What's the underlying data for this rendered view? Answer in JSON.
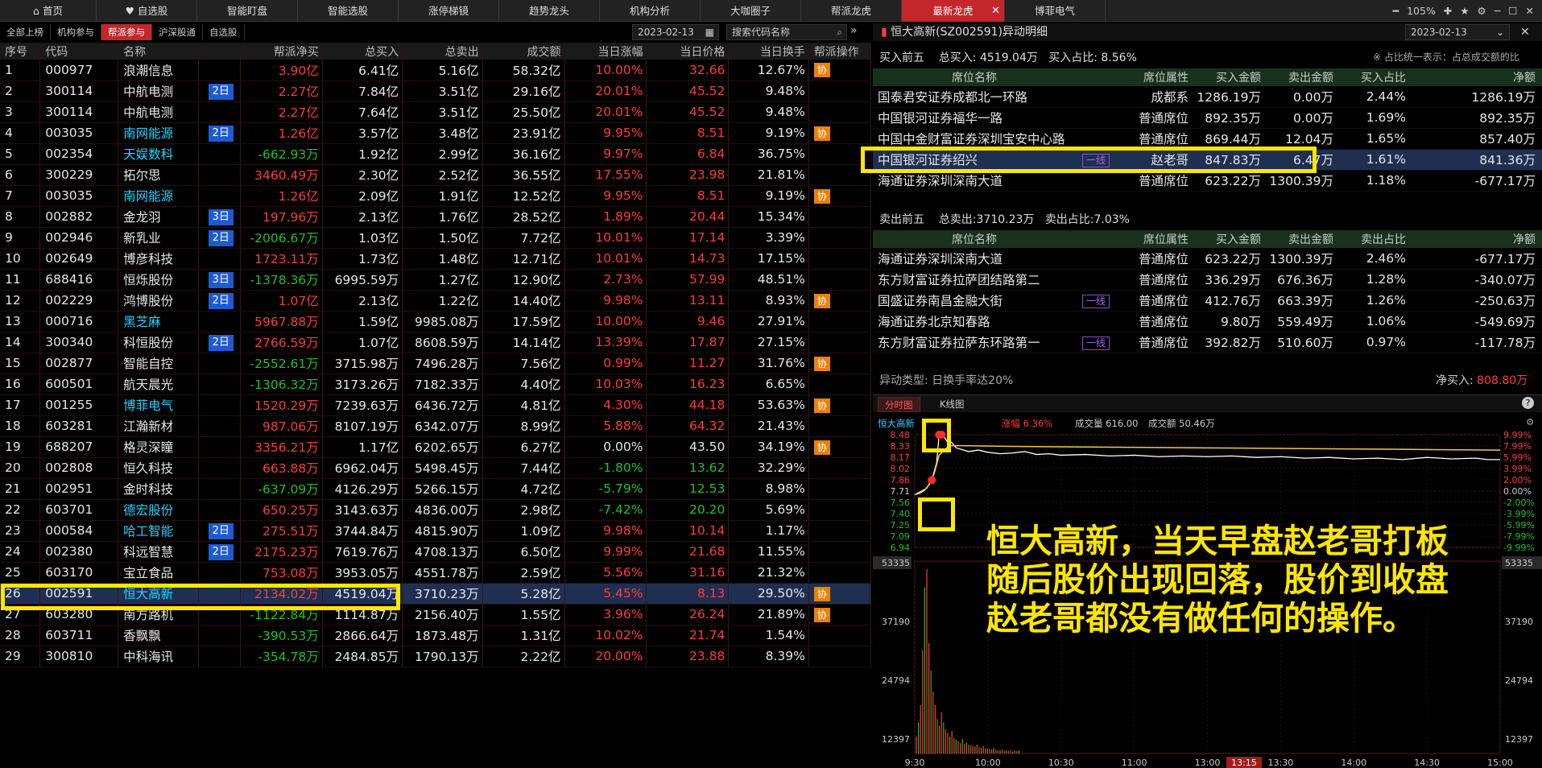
{
  "topbar": {
    "tabs": [
      "首页",
      "自选股",
      "智能盯盘",
      "智能选股",
      "涨停梯镜",
      "趋势龙头",
      "机构分析",
      "大咖圈子",
      "帮派龙虎",
      "最新龙虎",
      "博菲电气"
    ],
    "active_tab": "最新龙虎",
    "zoom": "105%"
  },
  "subtabs": [
    "全部上榜",
    "机构参与",
    "帮派参与",
    "沪深股通",
    "自选股"
  ],
  "active_subtab": "帮派参与",
  "date": "2023-02-13",
  "search_placeholder": "搜索代码名称",
  "table": {
    "headers": [
      "序号",
      "代码",
      "名称",
      "",
      "帮派净买",
      "总买入",
      "总卖出",
      "成交额",
      "当日涨幅",
      "当日价格",
      "当日换手",
      "帮派操作"
    ],
    "rows": [
      {
        "n": "1",
        "code": "000977",
        "name": "浪潮信息",
        "nc": "white",
        "badge": "",
        "net": "3.90亿",
        "netc": "red",
        "buy": "6.41亿",
        "sell": "5.16亿",
        "amt": "58.32亿",
        "chg": "10.00%",
        "chgc": "red",
        "price": "32.66",
        "pc": "red",
        "turn": "12.67%",
        "op": "协"
      },
      {
        "n": "2",
        "code": "300114",
        "name": "中航电测",
        "nc": "white",
        "badge": "2日",
        "net": "2.27亿",
        "netc": "red",
        "buy": "7.84亿",
        "sell": "3.51亿",
        "amt": "29.16亿",
        "chg": "20.01%",
        "chgc": "red",
        "price": "45.52",
        "pc": "red",
        "turn": "9.48%",
        "op": ""
      },
      {
        "n": "3",
        "code": "300114",
        "name": "中航电测",
        "nc": "white",
        "badge": "",
        "net": "2.27亿",
        "netc": "red",
        "buy": "7.64亿",
        "sell": "3.51亿",
        "amt": "25.50亿",
        "chg": "20.01%",
        "chgc": "red",
        "price": "45.52",
        "pc": "red",
        "turn": "9.48%",
        "op": ""
      },
      {
        "n": "4",
        "code": "003035",
        "name": "南网能源",
        "nc": "cyan",
        "badge": "2日",
        "net": "1.26亿",
        "netc": "red",
        "buy": "3.57亿",
        "sell": "3.48亿",
        "amt": "23.91亿",
        "chg": "9.95%",
        "chgc": "red",
        "price": "8.51",
        "pc": "red",
        "turn": "9.19%",
        "op": "协"
      },
      {
        "n": "5",
        "code": "002354",
        "name": "天娱数科",
        "nc": "cyan",
        "badge": "",
        "net": "-662.93万",
        "netc": "green",
        "buy": "1.92亿",
        "sell": "2.99亿",
        "amt": "36.16亿",
        "chg": "9.97%",
        "chgc": "red",
        "price": "6.84",
        "pc": "red",
        "turn": "36.75%",
        "op": ""
      },
      {
        "n": "6",
        "code": "300229",
        "name": "拓尔思",
        "nc": "white",
        "badge": "",
        "net": "3460.49万",
        "netc": "red",
        "buy": "2.30亿",
        "sell": "2.52亿",
        "amt": "36.55亿",
        "chg": "17.55%",
        "chgc": "red",
        "price": "23.98",
        "pc": "red",
        "turn": "21.81%",
        "op": ""
      },
      {
        "n": "7",
        "code": "003035",
        "name": "南网能源",
        "nc": "cyan",
        "badge": "",
        "net": "1.26亿",
        "netc": "red",
        "buy": "2.09亿",
        "sell": "1.91亿",
        "amt": "12.52亿",
        "chg": "9.95%",
        "chgc": "red",
        "price": "8.51",
        "pc": "red",
        "turn": "9.19%",
        "op": "协"
      },
      {
        "n": "8",
        "code": "002882",
        "name": "金龙羽",
        "nc": "white",
        "badge": "3日",
        "net": "197.96万",
        "netc": "red",
        "buy": "2.13亿",
        "sell": "1.76亿",
        "amt": "28.52亿",
        "chg": "1.89%",
        "chgc": "red",
        "price": "20.44",
        "pc": "red",
        "turn": "15.34%",
        "op": ""
      },
      {
        "n": "9",
        "code": "002946",
        "name": "新乳业",
        "nc": "white",
        "badge": "2日",
        "net": "-2006.67万",
        "netc": "green",
        "buy": "1.03亿",
        "sell": "1.50亿",
        "amt": "7.72亿",
        "chg": "10.01%",
        "chgc": "red",
        "price": "17.14",
        "pc": "red",
        "turn": "3.39%",
        "op": ""
      },
      {
        "n": "10",
        "code": "002649",
        "name": "博彦科技",
        "nc": "white",
        "badge": "",
        "net": "1723.11万",
        "netc": "red",
        "buy": "1.73亿",
        "sell": "1.48亿",
        "amt": "12.71亿",
        "chg": "10.01%",
        "chgc": "red",
        "price": "14.73",
        "pc": "red",
        "turn": "17.15%",
        "op": ""
      },
      {
        "n": "11",
        "code": "688416",
        "name": "恒烁股份",
        "nc": "white",
        "badge": "3日",
        "net": "-1378.36万",
        "netc": "green",
        "buy": "6995.59万",
        "sell": "1.27亿",
        "amt": "12.90亿",
        "chg": "2.73%",
        "chgc": "red",
        "price": "57.99",
        "pc": "red",
        "turn": "48.51%",
        "op": ""
      },
      {
        "n": "12",
        "code": "002229",
        "name": "鸿博股份",
        "nc": "white",
        "badge": "2日",
        "net": "1.07亿",
        "netc": "red",
        "buy": "2.13亿",
        "sell": "1.22亿",
        "amt": "14.40亿",
        "chg": "9.98%",
        "chgc": "red",
        "price": "13.11",
        "pc": "red",
        "turn": "8.93%",
        "op": "协"
      },
      {
        "n": "13",
        "code": "000716",
        "name": "黑芝麻",
        "nc": "cyan",
        "badge": "",
        "net": "5967.88万",
        "netc": "red",
        "buy": "1.59亿",
        "sell": "9985.08万",
        "amt": "17.59亿",
        "chg": "10.00%",
        "chgc": "red",
        "price": "9.46",
        "pc": "red",
        "turn": "27.91%",
        "op": ""
      },
      {
        "n": "14",
        "code": "300340",
        "name": "科恒股份",
        "nc": "white",
        "badge": "2日",
        "net": "2766.59万",
        "netc": "red",
        "buy": "1.07亿",
        "sell": "8608.59万",
        "amt": "14.14亿",
        "chg": "13.39%",
        "chgc": "red",
        "price": "17.87",
        "pc": "red",
        "turn": "27.15%",
        "op": ""
      },
      {
        "n": "15",
        "code": "002877",
        "name": "智能自控",
        "nc": "white",
        "badge": "",
        "net": "-2552.61万",
        "netc": "green",
        "buy": "3715.98万",
        "sell": "7496.28万",
        "amt": "7.56亿",
        "chg": "0.99%",
        "chgc": "red",
        "price": "11.27",
        "pc": "red",
        "turn": "31.76%",
        "op": "协"
      },
      {
        "n": "16",
        "code": "600501",
        "name": "航天晨光",
        "nc": "white",
        "badge": "",
        "net": "-1306.32万",
        "netc": "green",
        "buy": "3173.26万",
        "sell": "7182.33万",
        "amt": "4.40亿",
        "chg": "10.03%",
        "chgc": "red",
        "price": "16.23",
        "pc": "red",
        "turn": "6.65%",
        "op": ""
      },
      {
        "n": "17",
        "code": "001255",
        "name": "博菲电气",
        "nc": "cyan",
        "badge": "",
        "net": "1520.29万",
        "netc": "red",
        "buy": "7239.63万",
        "sell": "6436.72万",
        "amt": "4.81亿",
        "chg": "4.30%",
        "chgc": "red",
        "price": "44.18",
        "pc": "red",
        "turn": "53.63%",
        "op": "协"
      },
      {
        "n": "18",
        "code": "603281",
        "name": "江瀚新材",
        "nc": "white",
        "badge": "",
        "net": "987.06万",
        "netc": "red",
        "buy": "8107.19万",
        "sell": "6342.07万",
        "amt": "8.99亿",
        "chg": "5.88%",
        "chgc": "red",
        "price": "64.32",
        "pc": "red",
        "turn": "21.43%",
        "op": ""
      },
      {
        "n": "19",
        "code": "688207",
        "name": "格灵深瞳",
        "nc": "white",
        "badge": "",
        "net": "3356.21万",
        "netc": "red",
        "buy": "1.17亿",
        "sell": "6202.65万",
        "amt": "6.27亿",
        "chg": "0.00%",
        "chgc": "white",
        "price": "43.50",
        "pc": "white",
        "turn": "34.19%",
        "op": "协"
      },
      {
        "n": "20",
        "code": "002808",
        "name": "恒久科技",
        "nc": "white",
        "badge": "",
        "net": "663.88万",
        "netc": "red",
        "buy": "6962.04万",
        "sell": "5498.45万",
        "amt": "7.44亿",
        "chg": "-1.80%",
        "chgc": "green",
        "price": "13.62",
        "pc": "green",
        "turn": "32.29%",
        "op": ""
      },
      {
        "n": "21",
        "code": "002951",
        "name": "金时科技",
        "nc": "white",
        "badge": "",
        "net": "-637.09万",
        "netc": "green",
        "buy": "4126.29万",
        "sell": "5266.15万",
        "amt": "4.72亿",
        "chg": "-5.79%",
        "chgc": "green",
        "price": "12.53",
        "pc": "green",
        "turn": "8.98%",
        "op": ""
      },
      {
        "n": "22",
        "code": "603701",
        "name": "德宏股份",
        "nc": "cyan",
        "badge": "",
        "net": "650.25万",
        "netc": "red",
        "buy": "3143.63万",
        "sell": "4836.00万",
        "amt": "2.98亿",
        "chg": "-7.42%",
        "chgc": "green",
        "price": "20.20",
        "pc": "green",
        "turn": "5.69%",
        "op": ""
      },
      {
        "n": "23",
        "code": "000584",
        "name": "哈工智能",
        "nc": "cyan",
        "badge": "2日",
        "net": "275.51万",
        "netc": "red",
        "buy": "3744.84万",
        "sell": "4815.90万",
        "amt": "1.09亿",
        "chg": "9.98%",
        "chgc": "red",
        "price": "10.14",
        "pc": "red",
        "turn": "1.17%",
        "op": ""
      },
      {
        "n": "24",
        "code": "002380",
        "name": "科远智慧",
        "nc": "white",
        "badge": "2日",
        "net": "2175.23万",
        "netc": "red",
        "buy": "7619.76万",
        "sell": "4708.13万",
        "amt": "6.50亿",
        "chg": "9.99%",
        "chgc": "red",
        "price": "21.68",
        "pc": "red",
        "turn": "11.55%",
        "op": ""
      },
      {
        "n": "25",
        "code": "603170",
        "name": "宝立食品",
        "nc": "white",
        "badge": "",
        "net": "753.08万",
        "netc": "red",
        "buy": "3953.05万",
        "sell": "4551.78万",
        "amt": "2.59亿",
        "chg": "5.56%",
        "chgc": "red",
        "price": "31.16",
        "pc": "red",
        "turn": "21.32%",
        "op": ""
      },
      {
        "n": "26",
        "code": "002591",
        "name": "恒大高新",
        "nc": "cyan",
        "badge": "",
        "net": "2134.02万",
        "netc": "red",
        "buy": "4519.04万",
        "sell": "3710.23万",
        "amt": "5.28亿",
        "chg": "5.45%",
        "chgc": "red",
        "price": "8.13",
        "pc": "red",
        "turn": "29.50%",
        "op": "协"
      },
      {
        "n": "27",
        "code": "603280",
        "name": "南方路机",
        "nc": "white",
        "badge": "",
        "net": "-1122.84万",
        "netc": "green",
        "buy": "1114.87万",
        "sell": "2156.40万",
        "amt": "1.55亿",
        "chg": "3.96%",
        "chgc": "red",
        "price": "26.24",
        "pc": "red",
        "turn": "21.89%",
        "op": "协"
      },
      {
        "n": "28",
        "code": "603711",
        "name": "香飘飘",
        "nc": "white",
        "badge": "",
        "net": "-390.53万",
        "netc": "green",
        "buy": "2866.64万",
        "sell": "1873.48万",
        "amt": "1.31亿",
        "chg": "10.02%",
        "chgc": "red",
        "price": "21.74",
        "pc": "red",
        "turn": "1.54%",
        "op": ""
      },
      {
        "n": "29",
        "code": "300810",
        "name": "中科海讯",
        "nc": "white",
        "badge": "",
        "net": "-354.78万",
        "netc": "green",
        "buy": "2484.85万",
        "sell": "1790.13万",
        "amt": "2.22亿",
        "chg": "20.00%",
        "chgc": "red",
        "price": "23.88",
        "pc": "red",
        "turn": "8.39%",
        "op": ""
      }
    ],
    "selected_row": "26"
  },
  "detail": {
    "title": "恒大高新(SZ002591)异动明细",
    "date": "2023-02-13",
    "buy_summary": {
      "label": "买入前五",
      "total": "总买入: 4519.04万",
      "ratio": "买入占比: 8.56%"
    },
    "note": "※ 占比统一表示：占总成交额的比",
    "buy_headers": [
      "席位名称",
      "",
      "席位属性",
      "买入金额",
      "卖出金额",
      "买入占比",
      "净额"
    ],
    "buy_rows": [
      {
        "name": "国泰君安证券成都北一环路",
        "tag": "",
        "attr": "成都系",
        "buy": "1286.19万",
        "sell": "0.00万",
        "ratio": "2.44%",
        "net": "1286.19万"
      },
      {
        "name": "中国银河证券福华一路",
        "tag": "",
        "attr": "普通席位",
        "buy": "892.35万",
        "sell": "0.00万",
        "ratio": "1.69%",
        "net": "892.35万"
      },
      {
        "name": "中国中金财富证券深圳宝安中心路",
        "tag": "",
        "attr": "普通席位",
        "buy": "869.44万",
        "sell": "12.04万",
        "ratio": "1.65%",
        "net": "857.40万"
      },
      {
        "name": "中国银河证券绍兴",
        "tag": "一线",
        "attr": "赵老哥",
        "buy": "847.83万",
        "sell": "6.47万",
        "ratio": "1.61%",
        "net": "841.36万"
      },
      {
        "name": "海通证券深圳深南大道",
        "tag": "",
        "attr": "普通席位",
        "buy": "623.22万",
        "sell": "1300.39万",
        "ratio": "1.18%",
        "net": "-677.17万"
      }
    ],
    "sell_summary": {
      "label": "卖出前五",
      "total": "总卖出:3710.23万",
      "ratio": "卖出占比:7.03%"
    },
    "sell_headers": [
      "席位名称",
      "",
      "席位属性",
      "买入金额",
      "卖出金额",
      "卖出占比",
      "净额"
    ],
    "sell_rows": [
      {
        "name": "海通证券深圳深南大道",
        "tag": "",
        "attr": "普通席位",
        "buy": "623.22万",
        "sell": "1300.39万",
        "ratio": "2.46%",
        "net": "-677.17万"
      },
      {
        "name": "东方财富证券拉萨团结路第二",
        "tag": "",
        "attr": "普通席位",
        "buy": "336.29万",
        "sell": "676.36万",
        "ratio": "1.28%",
        "net": "-340.07万"
      },
      {
        "name": "国盛证券南昌金融大街",
        "tag": "一线",
        "attr": "普通席位",
        "buy": "412.76万",
        "sell": "663.39万",
        "ratio": "1.26%",
        "net": "-250.63万"
      },
      {
        "name": "海通证券北京知春路",
        "tag": "",
        "attr": "普通席位",
        "buy": "9.80万",
        "sell": "559.49万",
        "ratio": "1.06%",
        "net": "-549.69万"
      },
      {
        "name": "东方财富证券拉萨东环路第一",
        "tag": "一线",
        "attr": "普通席位",
        "buy": "392.82万",
        "sell": "510.60万",
        "ratio": "0.97%",
        "net": "-117.78万"
      }
    ],
    "anomaly_type": "异动类型: 日换手率达20%",
    "net_buy_label": "净买入:",
    "net_buy_value": "808.80万"
  },
  "chart_tabs": [
    "分时图",
    "K线图"
  ],
  "chart_info": {
    "name": "恒大高新",
    "change": "涨幅 6.36%",
    "volume": "成交量 616.00",
    "amount": "成交额 50.46万"
  },
  "chart_data": {
    "type": "line",
    "title": "",
    "price_ticks": [
      "8.48",
      "8.33",
      "8.17",
      "8.02",
      "7.86",
      "7.71",
      "7.56",
      "7.40",
      "7.25",
      "7.09",
      "6.94"
    ],
    "pct_ticks": [
      "9.99%",
      "7.99%",
      "5.99%",
      "3.99%",
      "2.00%",
      "0.00%",
      "-2.00%",
      "-3.99%",
      "-5.99%",
      "-7.99%",
      "-9.99%"
    ],
    "pct_colors": [
      "red",
      "red",
      "red",
      "red",
      "red",
      "white",
      "green",
      "green",
      "green",
      "green",
      "green"
    ],
    "vol_ticks": [
      "53335",
      "37190",
      "24794",
      "12397"
    ],
    "time_ticks": [
      "9:30",
      "10:00",
      "10:30",
      "11:00",
      "13:00",
      "13:30",
      "14:00",
      "14:30",
      "15:00"
    ],
    "cursor_time": "13:15",
    "ylim": [
      6.94,
      8.48
    ],
    "price_series": [
      [
        0,
        7.66
      ],
      [
        2,
        7.68
      ],
      [
        4,
        7.72
      ],
      [
        6,
        7.8
      ],
      [
        7,
        7.86
      ],
      [
        9,
        8.1
      ],
      [
        10,
        8.48
      ],
      [
        11,
        8.44
      ],
      [
        12,
        8.46
      ],
      [
        13,
        8.4
      ],
      [
        14,
        8.36
      ],
      [
        15,
        8.38
      ],
      [
        17,
        8.3
      ],
      [
        19,
        8.28
      ],
      [
        22,
        8.25
      ],
      [
        26,
        8.27
      ],
      [
        30,
        8.24
      ],
      [
        35,
        8.22
      ],
      [
        40,
        8.23
      ],
      [
        45,
        8.25
      ],
      [
        50,
        8.21
      ],
      [
        55,
        8.22
      ],
      [
        60,
        8.2
      ],
      [
        70,
        8.21
      ],
      [
        80,
        8.19
      ],
      [
        90,
        8.2
      ],
      [
        100,
        8.18
      ],
      [
        110,
        8.19
      ],
      [
        120,
        8.18
      ],
      [
        130,
        8.19
      ],
      [
        140,
        8.17
      ],
      [
        150,
        8.18
      ],
      [
        160,
        8.16
      ],
      [
        170,
        8.17
      ],
      [
        180,
        8.15
      ],
      [
        190,
        8.16
      ],
      [
        200,
        8.14
      ],
      [
        210,
        8.17
      ],
      [
        220,
        8.15
      ],
      [
        230,
        8.16
      ],
      [
        235,
        8.14
      ],
      [
        240,
        8.14
      ]
    ],
    "avg_series": [
      [
        0,
        7.66
      ],
      [
        5,
        7.75
      ],
      [
        8,
        7.95
      ],
      [
        10,
        8.2
      ],
      [
        14,
        8.33
      ],
      [
        20,
        8.33
      ],
      [
        40,
        8.32
      ],
      [
        80,
        8.31
      ],
      [
        120,
        8.3
      ],
      [
        160,
        8.29
      ],
      [
        200,
        8.28
      ],
      [
        240,
        8.27
      ]
    ],
    "volume_series": [
      5000,
      9000,
      14000,
      30000,
      48000,
      53335,
      32000,
      24000,
      18000,
      14000,
      10000,
      8000,
      12000,
      9000,
      7000,
      6000,
      5000,
      6500,
      4500,
      4000,
      3500,
      3000,
      4200,
      2800,
      3200,
      2500,
      2400,
      2200,
      2000,
      2600,
      1800,
      1600,
      2100,
      1500,
      1400,
      1300,
      1200,
      1600,
      1100,
      1000,
      900,
      1200,
      800,
      900,
      700,
      1000,
      600,
      800,
      700,
      900
    ],
    "markers": [
      [
        10,
        8.48
      ],
      [
        11,
        8.48
      ],
      [
        7,
        7.86
      ]
    ]
  },
  "annotation": [
    "恒大高新，当天早盘赵老哥打板",
    "随后股价出现回落，股价到收盘",
    "赵老哥都没有做任何的操作。"
  ]
}
